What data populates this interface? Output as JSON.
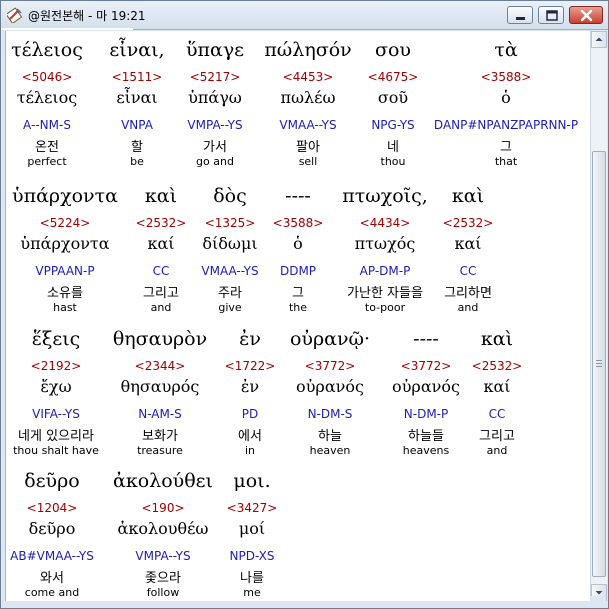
{
  "window": {
    "title": "@원전본해 - 마 19:21"
  },
  "icons": {
    "app": "bible-app-icon",
    "minimize": "minimize-icon",
    "maximize": "maximize-icon",
    "close": "close-icon"
  },
  "colors": {
    "strong_number": "#a00000",
    "parsing": "#1c1cb8",
    "text": "#000000"
  },
  "rows": [
    {
      "words": [
        {
          "greek": "τέλειος",
          "strong": "<5046>",
          "lemma": "τέλειος",
          "parse": "A--NM-S",
          "korean": "온전",
          "english": "perfect"
        },
        {
          "greek": "εἶναι,",
          "strong": "<1511>",
          "lemma": "εἶναι",
          "parse": "VNPA",
          "korean": "할",
          "english": "be"
        },
        {
          "greek": "ὕπαγε",
          "strong": "<5217>",
          "lemma": "ὑπάγω",
          "parse": "VMPA--YS",
          "korean": "가서",
          "english": "go and"
        },
        {
          "greek": "πώλησόν",
          "strong": "<4453>",
          "lemma": "πωλέω",
          "parse": "VMAA--YS",
          "korean": "팔아",
          "english": "sell"
        },
        {
          "greek": "σου",
          "strong": "<4675>",
          "lemma": "σοῦ",
          "parse": "NPG-YS",
          "korean": "네",
          "english": "thou"
        },
        {
          "greek": "τὰ",
          "strong": "<3588>",
          "lemma": "ὁ",
          "parse": "DANP#NPANZPAPRNN-P",
          "korean": "그",
          "english": "that"
        }
      ]
    },
    {
      "words": [
        {
          "greek": "ὑπάρχοντα",
          "strong": "<5224>",
          "lemma": "ὑπάρχοντα",
          "parse": "VPPAAN-P",
          "korean": "소유를",
          "english": "hast"
        },
        {
          "greek": "καὶ",
          "strong": "<2532>",
          "lemma": "καί",
          "parse": "CC",
          "korean": "그리고",
          "english": "and"
        },
        {
          "greek": "δὸς",
          "strong": "<1325>",
          "lemma": "δίδωμι",
          "parse": "VMAA--YS",
          "korean": "주라",
          "english": "give"
        },
        {
          "greek": "----",
          "strong": "<3588>",
          "lemma": "ὁ",
          "parse": "DDMP",
          "korean": "그",
          "english": "the"
        },
        {
          "greek": "πτωχοῖς,",
          "strong": "<4434>",
          "lemma": "πτωχός",
          "parse": "AP-DM-P",
          "korean": "가난한 자들을",
          "english": "to-poor"
        },
        {
          "greek": "καὶ",
          "strong": "<2532>",
          "lemma": "καί",
          "parse": "CC",
          "korean": "그리하면",
          "english": "and"
        }
      ]
    },
    {
      "words": [
        {
          "greek": "ἕξεις",
          "strong": "<2192>",
          "lemma": "ἔχω",
          "parse": "VIFA--YS",
          "korean": "네게 있으리라",
          "english": "thou shalt have"
        },
        {
          "greek": "θησαυρὸν",
          "strong": "<2344>",
          "lemma": "θησαυρός",
          "parse": "N-AM-S",
          "korean": "보화가",
          "english": "treasure"
        },
        {
          "greek": "ἐν",
          "strong": "<1722>",
          "lemma": "ἐν",
          "parse": "PD",
          "korean": "에서",
          "english": "in"
        },
        {
          "greek": "οὐρανῷ·",
          "strong": "<3772>",
          "lemma": "οὐρανός",
          "parse": "N-DM-S",
          "korean": "하늘",
          "english": "heaven"
        },
        {
          "greek": "----",
          "strong": "<3772>",
          "lemma": "οὐρανός",
          "parse": "N-DM-P",
          "korean": "하늘들",
          "english": "heavens"
        },
        {
          "greek": "καὶ",
          "strong": "<2532>",
          "lemma": "καί",
          "parse": "CC",
          "korean": "그리고",
          "english": "and"
        }
      ]
    },
    {
      "words": [
        {
          "greek": "δεῦρο",
          "strong": "<1204>",
          "lemma": "δεῦρο",
          "parse": "AB#VMAA--YS",
          "korean": "와서",
          "english": "come and"
        },
        {
          "greek": "ἀκολούθει",
          "strong": "<190>",
          "lemma": "ἀκολουθέω",
          "parse": "VMPA--YS",
          "korean": "좇으라",
          "english": "follow"
        },
        {
          "greek": "μοι.",
          "strong": "<3427>",
          "lemma": "μοί",
          "parse": "NPD-XS",
          "korean": "나를",
          "english": "me"
        }
      ]
    }
  ]
}
